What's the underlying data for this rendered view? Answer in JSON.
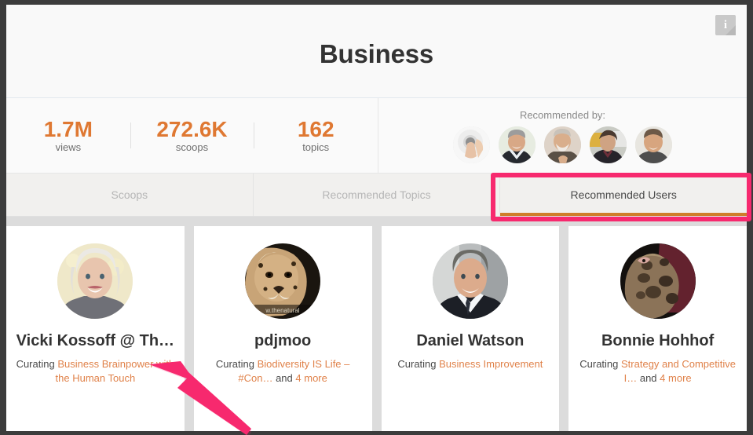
{
  "header": {
    "title": "Business",
    "info_icon": "info-icon",
    "info_glyph": "i"
  },
  "stats": [
    {
      "value": "1.7M",
      "label": "views"
    },
    {
      "value": "272.6K",
      "label": "scoops"
    },
    {
      "value": "162",
      "label": "topics"
    }
  ],
  "recommended_by": {
    "label": "Recommended by:",
    "avatars": [
      {
        "name": "avatar-recommender-1",
        "alt": "finger pressing button"
      },
      {
        "name": "avatar-recommender-2",
        "alt": "smiling man in suit"
      },
      {
        "name": "avatar-recommender-3",
        "alt": "bearded man"
      },
      {
        "name": "avatar-recommender-4",
        "alt": "man in dark coat"
      },
      {
        "name": "avatar-recommender-5",
        "alt": "man outdoors"
      }
    ]
  },
  "tabs": [
    {
      "label": "Scoops",
      "active": false
    },
    {
      "label": "Recommended Topics",
      "active": false
    },
    {
      "label": "Recommended Users",
      "active": true
    }
  ],
  "users": [
    {
      "name": "Vicki Kossoff @ Th…",
      "curating_label": "Curating",
      "topic": "Business Brainpower with the Human Touch",
      "and_label": "",
      "more": ""
    },
    {
      "name": "pdjmoo",
      "curating_label": "Curating",
      "topic": "Biodiversity IS Life – #Con…",
      "and_label": "and",
      "more": "4 more"
    },
    {
      "name": "Daniel Watson",
      "curating_label": "Curating",
      "topic": "Business Improvement",
      "and_label": "",
      "more": ""
    },
    {
      "name": "Bonnie Hohhof",
      "curating_label": "Curating",
      "topic": "Strategy and Competitive I…",
      "and_label": "and",
      "more": "4 more"
    }
  ],
  "colors": {
    "accent_orange": "#df7832",
    "topic_orange": "#e0824a",
    "tab_underline": "#cf7d2a",
    "annotation_pink": "#f7296e",
    "frame_dark": "#3c3c3c"
  }
}
